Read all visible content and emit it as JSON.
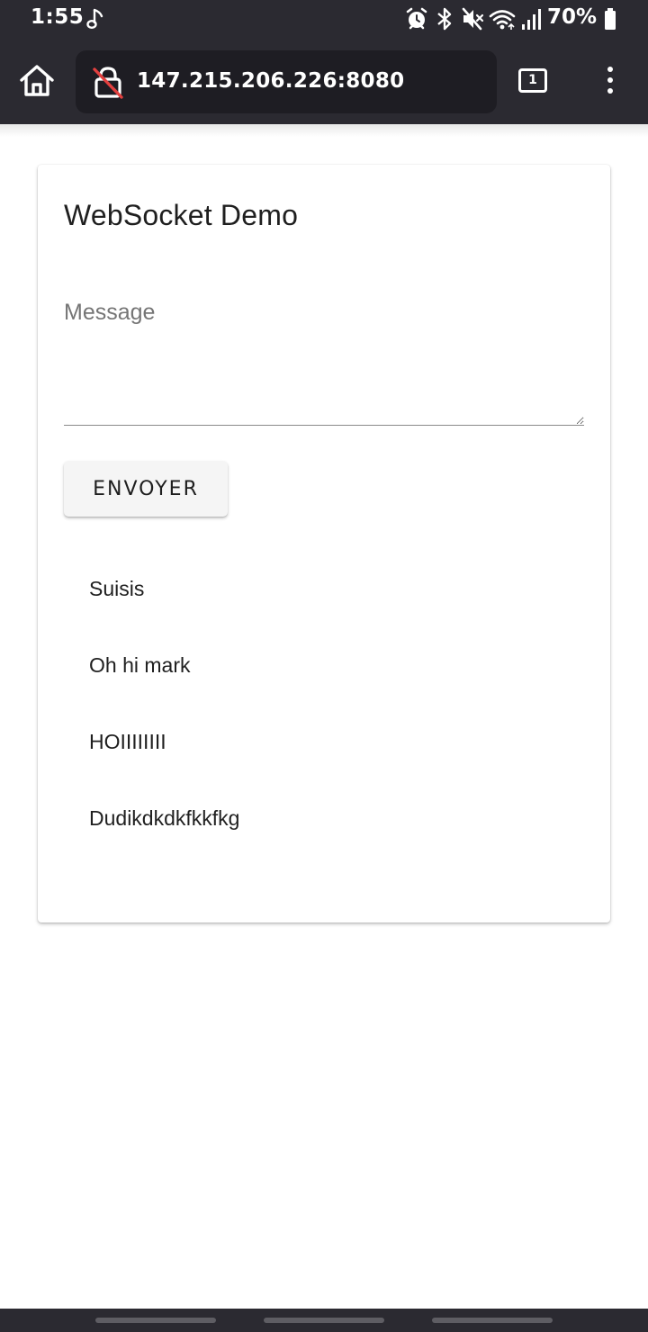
{
  "status_bar": {
    "time": "1:55",
    "battery_percent": "70%",
    "icons": [
      "music-note-icon",
      "alarm-icon",
      "bluetooth-icon",
      "mute-icon",
      "wifi-icon",
      "signal-icon",
      "battery-icon"
    ]
  },
  "browser": {
    "url": "147.215.206.226:8080",
    "tab_count": "1",
    "icons": [
      "home-icon",
      "not-secure-lock-icon",
      "tabs-icon",
      "overflow-menu-icon"
    ]
  },
  "page": {
    "title": "WebSocket Demo",
    "message_placeholder": "Message",
    "send_label": "ENVOYER",
    "messages": [
      "Suisis",
      "Oh hi mark",
      "HOIIIIIIII",
      "Dudikdkdkfkkfkg"
    ]
  },
  "colors": {
    "chrome_background": "#2b2a31",
    "url_box": "#1e1d23",
    "insecure_slash": "#e2403f",
    "button_background": "#f5f5f5"
  }
}
